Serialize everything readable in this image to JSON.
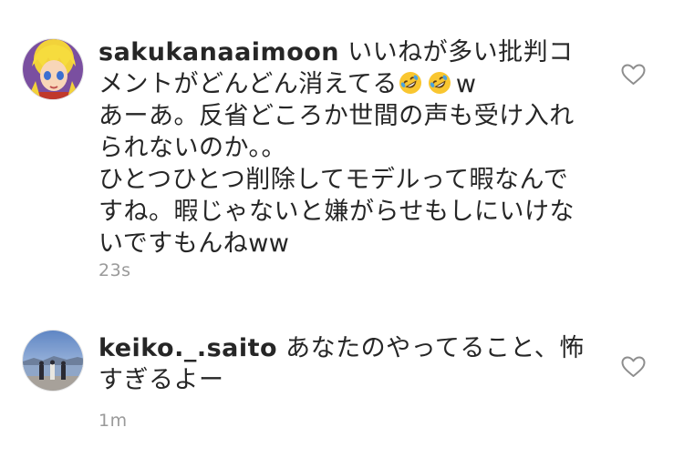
{
  "comments": [
    {
      "username": "sakukanaaimoon",
      "lines": [
        " いいねが多い批判コメントがどんどん消えてる",
        "w",
        "あーあ。反省どころか世間の声も受け入れられないのか。。",
        "ひとつひとつ削除してモデルって暇なんですね。暇じゃないと嫌がらせもしにいけないですもんねww"
      ],
      "emoji": [
        "rolling-on-floor-laughing-emoji",
        "rolling-on-floor-laughing-emoji"
      ],
      "time": "23s",
      "avatar": "anime-character-avatar",
      "like_icon": "heart-outline-icon"
    },
    {
      "username": "keiko._.saito",
      "lines": [
        " あなたのやってること、怖すぎるよー"
      ],
      "time": "1m",
      "avatar": "lakeside-photo-avatar",
      "like_icon": "heart-outline-icon"
    }
  ],
  "colors": {
    "text": "#262626",
    "meta": "#9a9a9a",
    "heart_stroke": "#8e8e8e"
  }
}
